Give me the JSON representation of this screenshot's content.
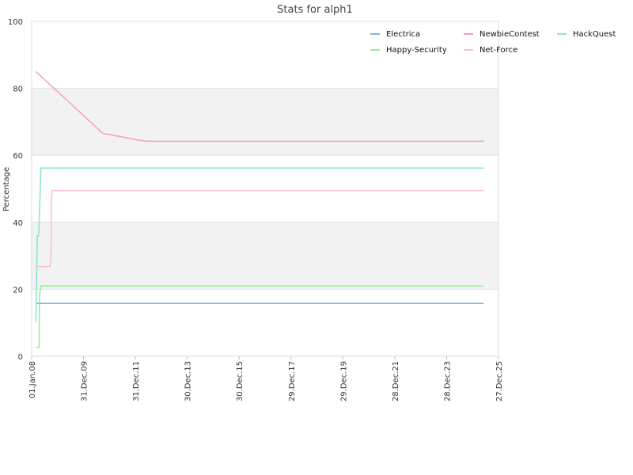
{
  "chart_data": {
    "type": "line",
    "title": "Stats for alph1",
    "xlabel": "",
    "ylabel": "Percentage",
    "ylim": [
      0,
      100
    ],
    "yticks": [
      0,
      20,
      40,
      60,
      80,
      100
    ],
    "xlim": [
      "2008-01-01",
      "2025-12-27"
    ],
    "xticks": [
      {
        "date": "2008-01-01",
        "label": "01.Jan.08"
      },
      {
        "date": "2009-12-31",
        "label": "31.Dec.09"
      },
      {
        "date": "2011-12-31",
        "label": "31.Dec.11"
      },
      {
        "date": "2013-12-30",
        "label": "30.Dec.13"
      },
      {
        "date": "2015-12-30",
        "label": "30.Dec.15"
      },
      {
        "date": "2017-12-29",
        "label": "29.Dec.17"
      },
      {
        "date": "2019-12-29",
        "label": "29.Dec.19"
      },
      {
        "date": "2021-12-28",
        "label": "28.Dec.21"
      },
      {
        "date": "2023-12-28",
        "label": "28.Dec.23"
      },
      {
        "date": "2025-12-27",
        "label": "27.Dec.25"
      }
    ],
    "bands": [
      [
        20,
        40
      ],
      [
        60,
        80
      ]
    ],
    "grid": true,
    "legend_position": "top-right",
    "series": [
      {
        "name": "Electrica",
        "color": "#7ab6e6",
        "points": [
          [
            "2008-03-01",
            15.8
          ],
          [
            "2025-06-01",
            15.8
          ]
        ]
      },
      {
        "name": "Happy-Security",
        "color": "#90ee90",
        "points": [
          [
            "2008-03-01",
            2.7
          ],
          [
            "2008-04-15",
            2.7
          ],
          [
            "2008-04-20",
            18
          ],
          [
            "2008-05-10",
            21
          ],
          [
            "2025-06-01",
            21
          ]
        ]
      },
      {
        "name": "NewbieContest",
        "color": "#f5a0b8",
        "points": [
          [
            "2008-03-01",
            85
          ],
          [
            "2010-10-01",
            66.5
          ],
          [
            "2011-01-01",
            66.2
          ],
          [
            "2012-03-01",
            64.5
          ],
          [
            "2012-06-01",
            64.2
          ],
          [
            "2025-06-01",
            64.2
          ]
        ]
      },
      {
        "name": "Net-Force",
        "color": "#f7c0cb",
        "points": [
          [
            "2008-03-01",
            26.8
          ],
          [
            "2008-09-15",
            26.8
          ],
          [
            "2008-09-30",
            30
          ],
          [
            "2008-10-05",
            46
          ],
          [
            "2008-10-15",
            49.5
          ],
          [
            "2025-06-01",
            49.5
          ]
        ]
      },
      {
        "name": "HackQuest",
        "color": "#86e3d4",
        "points": [
          [
            "2008-03-01",
            10
          ],
          [
            "2008-03-20",
            36
          ],
          [
            "2008-04-10",
            36
          ],
          [
            "2008-05-10",
            56.2
          ],
          [
            "2025-06-01",
            56.2
          ]
        ]
      }
    ]
  }
}
